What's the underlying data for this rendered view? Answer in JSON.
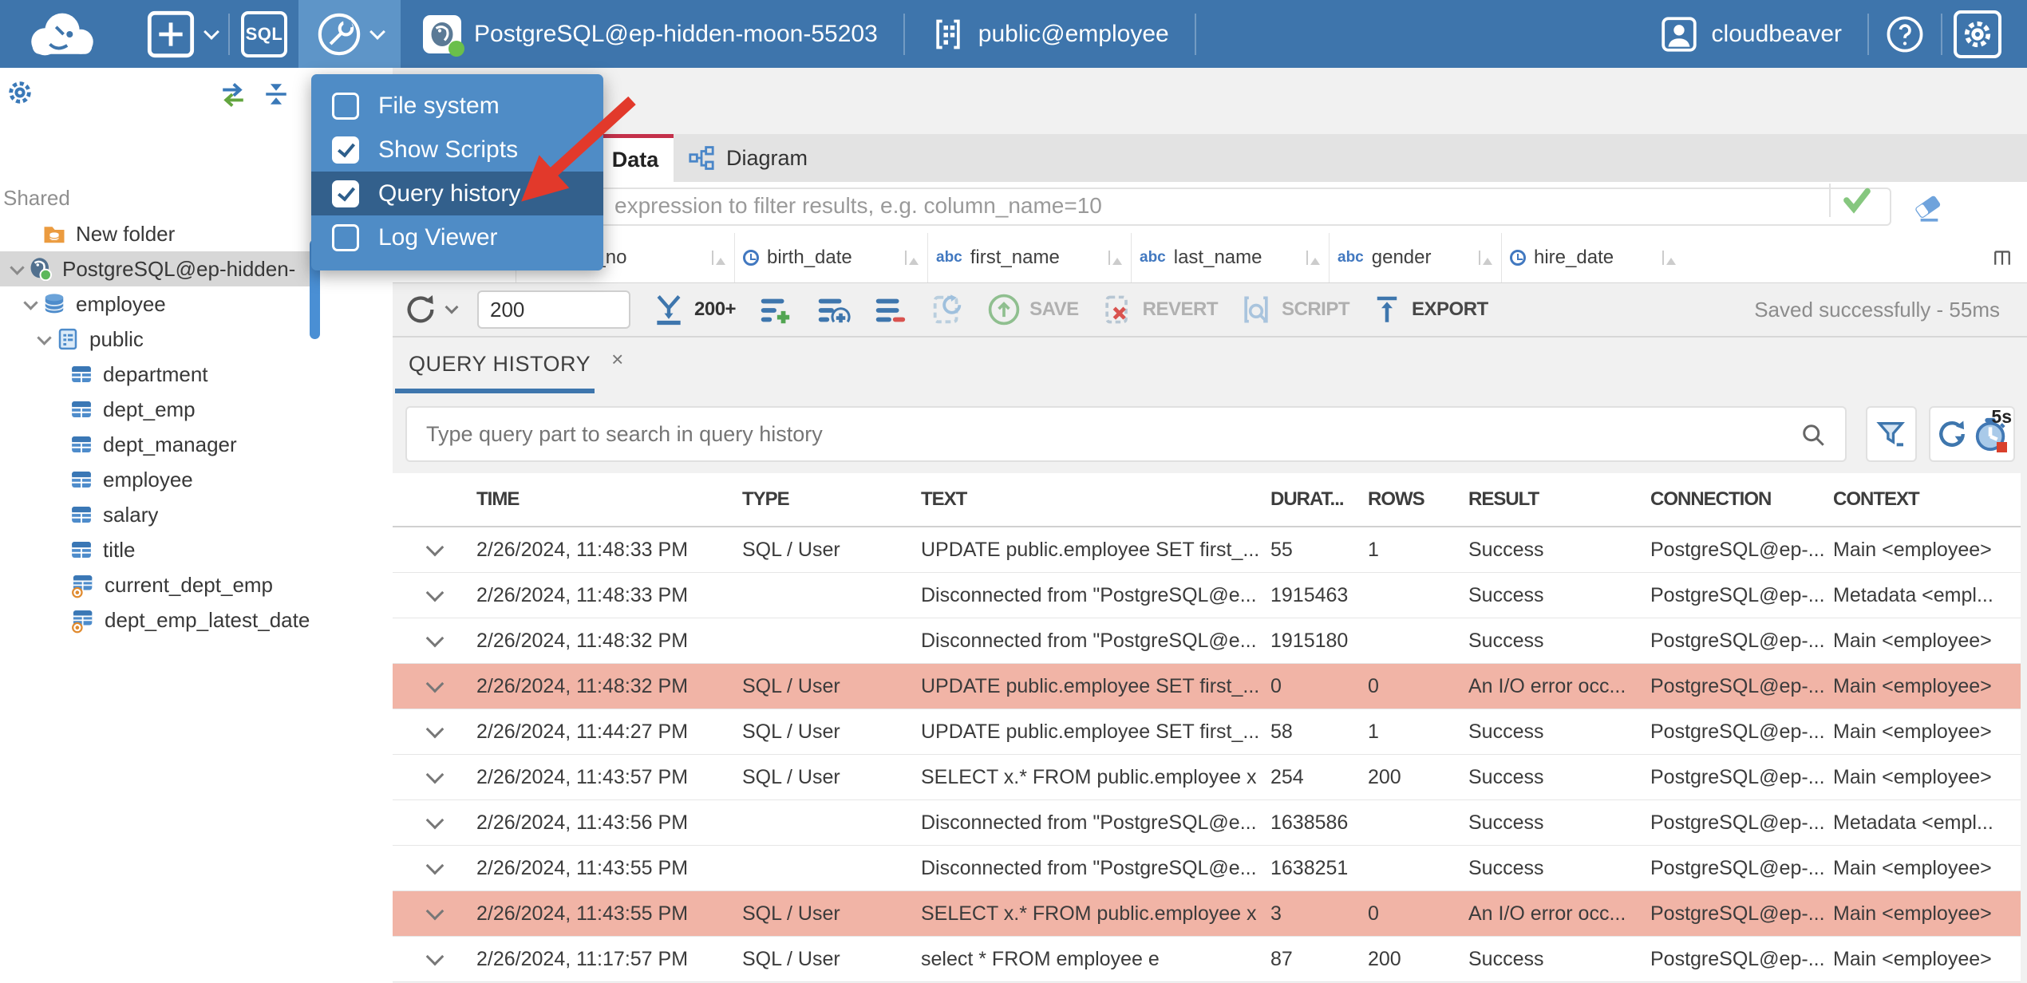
{
  "colors": {
    "topbar": "#3e75ac",
    "topbar_active": "#5e95c8",
    "menu_bg": "#4f8cc6",
    "menu_highlight": "#33608c",
    "accent_blue": "#3e76ad",
    "icon_blue": "#4e8ccb",
    "tab_red": "#c4304a",
    "arrow_red": "#e2392b",
    "error_row": "#f1b4a6",
    "status_green": "#6abf4b",
    "folder_orange": "#eb9b3f",
    "view_eye_orange": "#e08a2e"
  },
  "topbar": {
    "sql_label": "SQL",
    "connection": "PostgreSQL@ep-hidden-moon-55203",
    "schema": "public@employee",
    "user": "cloudbeaver"
  },
  "tools_menu": {
    "items": [
      {
        "label": "File system",
        "checked": false,
        "highlighted": false
      },
      {
        "label": "Show Scripts",
        "checked": true,
        "highlighted": false
      },
      {
        "label": "Query history",
        "checked": true,
        "highlighted": true
      },
      {
        "label": "Log Viewer",
        "checked": false,
        "highlighted": false
      }
    ]
  },
  "sidebar": {
    "section_label": "Shared",
    "tree": [
      {
        "label": "New folder",
        "icon": "folder",
        "level": 1,
        "chevron": false,
        "selected": false
      },
      {
        "label": "PostgreSQL@ep-hidden-",
        "icon": "postgres",
        "level": 0,
        "chevron": true,
        "selected": true
      },
      {
        "label": "employee",
        "icon": "database",
        "level": 1,
        "chevron": true,
        "selected": false
      },
      {
        "label": "public",
        "icon": "schema",
        "level": 2,
        "chevron": true,
        "selected": false
      },
      {
        "label": "department",
        "icon": "table",
        "level": 3,
        "chevron": false,
        "selected": false
      },
      {
        "label": "dept_emp",
        "icon": "table",
        "level": 3,
        "chevron": false,
        "selected": false
      },
      {
        "label": "dept_manager",
        "icon": "table",
        "level": 3,
        "chevron": false,
        "selected": false
      },
      {
        "label": "employee",
        "icon": "table",
        "level": 3,
        "chevron": false,
        "selected": false
      },
      {
        "label": "salary",
        "icon": "table",
        "level": 3,
        "chevron": false,
        "selected": false
      },
      {
        "label": "title",
        "icon": "table",
        "level": 3,
        "chevron": false,
        "selected": false
      },
      {
        "label": "current_dept_emp",
        "icon": "view",
        "level": 3,
        "chevron": false,
        "selected": false
      },
      {
        "label": "dept_emp_latest_date",
        "icon": "view",
        "level": 3,
        "chevron": false,
        "selected": false
      }
    ]
  },
  "view_tabs": {
    "data": "Data",
    "diagram": "Diagram"
  },
  "filter": {
    "placeholder": "expression to filter results, e.g. column_name=10"
  },
  "grid": {
    "rownum_symbol": "#",
    "columns": [
      {
        "name": "emp_no",
        "type": "123"
      },
      {
        "name": "birth_date",
        "type": "date"
      },
      {
        "name": "first_name",
        "type": "abc"
      },
      {
        "name": "last_name",
        "type": "abc"
      },
      {
        "name": "gender",
        "type": "abc"
      },
      {
        "name": "hire_date",
        "type": "date"
      }
    ]
  },
  "results_toolbar": {
    "row_limit": "200",
    "fetch_label": "200+",
    "save_label": "SAVE",
    "revert_label": "REVERT",
    "script_label": "SCRIPT",
    "export_label": "EXPORT",
    "status": "Saved successfully - 55ms"
  },
  "history_panel": {
    "tab_label": "QUERY HISTORY",
    "close_symbol": "×",
    "search_placeholder": "Type query part to search in query history",
    "refresh_interval": "5s",
    "columns": [
      "TIME",
      "TYPE",
      "TEXT",
      "DURAT...",
      "ROWS",
      "RESULT",
      "CONNECTION",
      "CONTEXT"
    ],
    "rows": [
      {
        "time": "2/26/2024, 11:48:33 PM",
        "type": "SQL / User",
        "text": "UPDATE public.employee SET first_...",
        "duration": "55",
        "rowcount": "1",
        "result": "Success",
        "connection": "PostgreSQL@ep-...",
        "context": "Main <employee>",
        "error": false
      },
      {
        "time": "2/26/2024, 11:48:33 PM",
        "type": "",
        "text": "Disconnected from \"PostgreSQL@e...",
        "duration": "1915463",
        "rowcount": "",
        "result": "Success",
        "connection": "PostgreSQL@ep-...",
        "context": "Metadata <empl...",
        "error": false
      },
      {
        "time": "2/26/2024, 11:48:32 PM",
        "type": "",
        "text": "Disconnected from \"PostgreSQL@e...",
        "duration": "1915180",
        "rowcount": "",
        "result": "Success",
        "connection": "PostgreSQL@ep-...",
        "context": "Main <employee>",
        "error": false
      },
      {
        "time": "2/26/2024, 11:48:32 PM",
        "type": "SQL / User",
        "text": "UPDATE public.employee SET first_...",
        "duration": "0",
        "rowcount": "0",
        "result": "An I/O error occ...",
        "connection": "PostgreSQL@ep-...",
        "context": "Main <employee>",
        "error": true
      },
      {
        "time": "2/26/2024, 11:44:27 PM",
        "type": "SQL / User",
        "text": "UPDATE public.employee SET first_...",
        "duration": "58",
        "rowcount": "1",
        "result": "Success",
        "connection": "PostgreSQL@ep-...",
        "context": "Main <employee>",
        "error": false
      },
      {
        "time": "2/26/2024, 11:43:57 PM",
        "type": "SQL / User",
        "text": "SELECT x.* FROM public.employee x",
        "duration": "254",
        "rowcount": "200",
        "result": "Success",
        "connection": "PostgreSQL@ep-...",
        "context": "Main <employee>",
        "error": false
      },
      {
        "time": "2/26/2024, 11:43:56 PM",
        "type": "",
        "text": "Disconnected from \"PostgreSQL@e...",
        "duration": "1638586",
        "rowcount": "",
        "result": "Success",
        "connection": "PostgreSQL@ep-...",
        "context": "Metadata <empl...",
        "error": false
      },
      {
        "time": "2/26/2024, 11:43:55 PM",
        "type": "",
        "text": "Disconnected from \"PostgreSQL@e...",
        "duration": "1638251",
        "rowcount": "",
        "result": "Success",
        "connection": "PostgreSQL@ep-...",
        "context": "Main <employee>",
        "error": false
      },
      {
        "time": "2/26/2024, 11:43:55 PM",
        "type": "SQL / User",
        "text": "SELECT x.* FROM public.employee x",
        "duration": "3",
        "rowcount": "0",
        "result": "An I/O error occ...",
        "connection": "PostgreSQL@ep-...",
        "context": "Main <employee>",
        "error": true
      },
      {
        "time": "2/26/2024, 11:17:57 PM",
        "type": "SQL / User",
        "text": "select * FROM employee e",
        "duration": "87",
        "rowcount": "200",
        "result": "Success",
        "connection": "PostgreSQL@ep-...",
        "context": "Main <employee>",
        "error": false
      }
    ]
  }
}
